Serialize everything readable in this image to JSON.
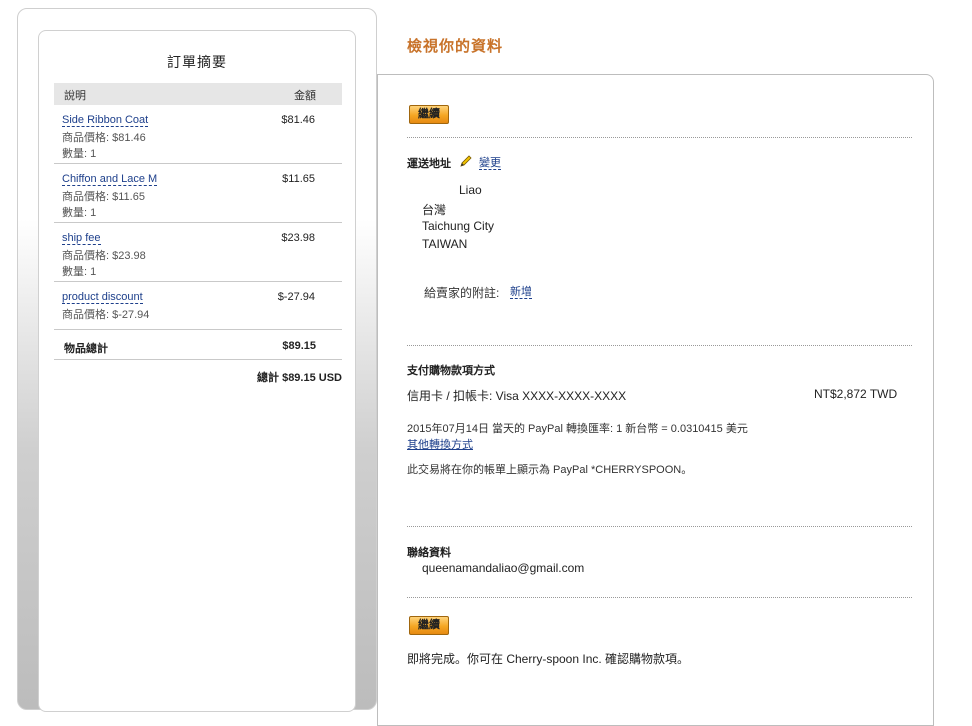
{
  "summary": {
    "title": "訂單摘要",
    "header": {
      "description": "說明",
      "amount": "金額"
    },
    "items": [
      {
        "name": "Side Ribbon Coat",
        "amount": "$81.46",
        "price": "商品價格: $81.46",
        "qty": "數量: 1"
      },
      {
        "name": "Chiffon and Lace M",
        "amount": "$11.65",
        "price": "商品價格: $11.65",
        "qty": "數量: 1"
      },
      {
        "name": "ship fee",
        "amount": "$23.98",
        "price": "商品價格: $23.98",
        "qty": "數量: 1"
      },
      {
        "name": "product discount",
        "amount": "$-27.94",
        "price": "商品價格: $-27.94"
      }
    ],
    "subtotal_label": "物品總計",
    "subtotal_value": "$89.15",
    "total": "總計 $89.15 USD"
  },
  "review": {
    "title": "檢視你的資料",
    "continue_label": "繼續",
    "shipping": {
      "label": "運送地址",
      "change_link": "變更",
      "name": "Liao",
      "line1": "台灣",
      "line2": "Taichung City",
      "line3": "TAIWAN",
      "note_label": "給賣家的附註:",
      "note_link": "新增"
    },
    "payment": {
      "label": "支付購物款項方式",
      "method": "信用卡 / 扣帳卡: Visa XXXX-XXXX-XXXX",
      "amount": "NT$2,872 TWD",
      "rate": "2015年07月14日 當天的 PayPal 轉換匯率: 1 新台幣 = 0.0310415 美元",
      "other_link": "其他轉換方式",
      "statement": "此交易將在你的帳單上顯示為 PayPal *CHERRYSPOON。"
    },
    "contact": {
      "label": "聯絡資料",
      "email": "queenamandaliao@gmail.com"
    },
    "footer_note": "即將完成。你可在 Cherry-spoon Inc. 確認購物款項。"
  },
  "colors": {
    "accent": "#c8732a",
    "link": "#1d3f8b",
    "button": "#f5a623"
  }
}
